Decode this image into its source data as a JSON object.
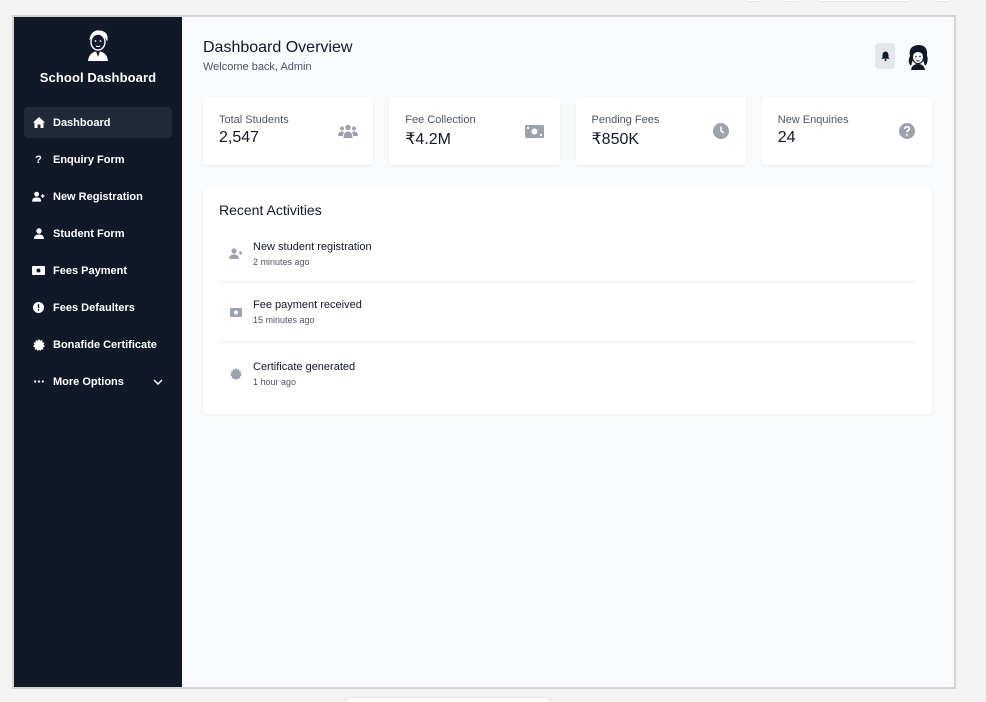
{
  "sidebar": {
    "title": "School Dashboard",
    "items": [
      {
        "label": "Dashboard",
        "icon": "home-icon",
        "active": true
      },
      {
        "label": "Enquiry Form",
        "icon": "question-icon"
      },
      {
        "label": "New Registration",
        "icon": "user-plus-icon"
      },
      {
        "label": "Student Form",
        "icon": "user-icon"
      },
      {
        "label": "Fees Payment",
        "icon": "money-bill-icon"
      },
      {
        "label": "Fees Defaulters",
        "icon": "exclamation-circle-icon"
      },
      {
        "label": "Bonafide Certificate",
        "icon": "certificate-icon"
      },
      {
        "label": "More Options",
        "icon": "ellipsis-icon"
      }
    ]
  },
  "header": {
    "title": "Dashboard Overview",
    "subtitle": "Welcome back, Admin"
  },
  "stats": [
    {
      "label": "Total Students",
      "value": "2,547",
      "icon": "users-icon"
    },
    {
      "label": "Fee Collection",
      "value": "₹4.2M",
      "icon": "money-bill-icon"
    },
    {
      "label": "Pending Fees",
      "value": "₹850K",
      "icon": "clock-icon"
    },
    {
      "label": "New Enquiries",
      "value": "24",
      "icon": "question-circle-icon"
    }
  ],
  "activities": {
    "title": "Recent Activities",
    "items": [
      {
        "name": "New student registration",
        "time": "2 minutes ago",
        "icon": "user-plus-icon"
      },
      {
        "name": "Fee payment received",
        "time": "15 minutes ago",
        "icon": "money-bill-icon"
      },
      {
        "name": "Certificate generated",
        "time": "1 hour ago",
        "icon": "certificate-icon"
      }
    ]
  },
  "colors": {
    "sidebar_bg": "#111827",
    "active_item_bg": "#1f2937",
    "main_bg": "#f9fafb",
    "icon_gray": "#9ca3af"
  }
}
